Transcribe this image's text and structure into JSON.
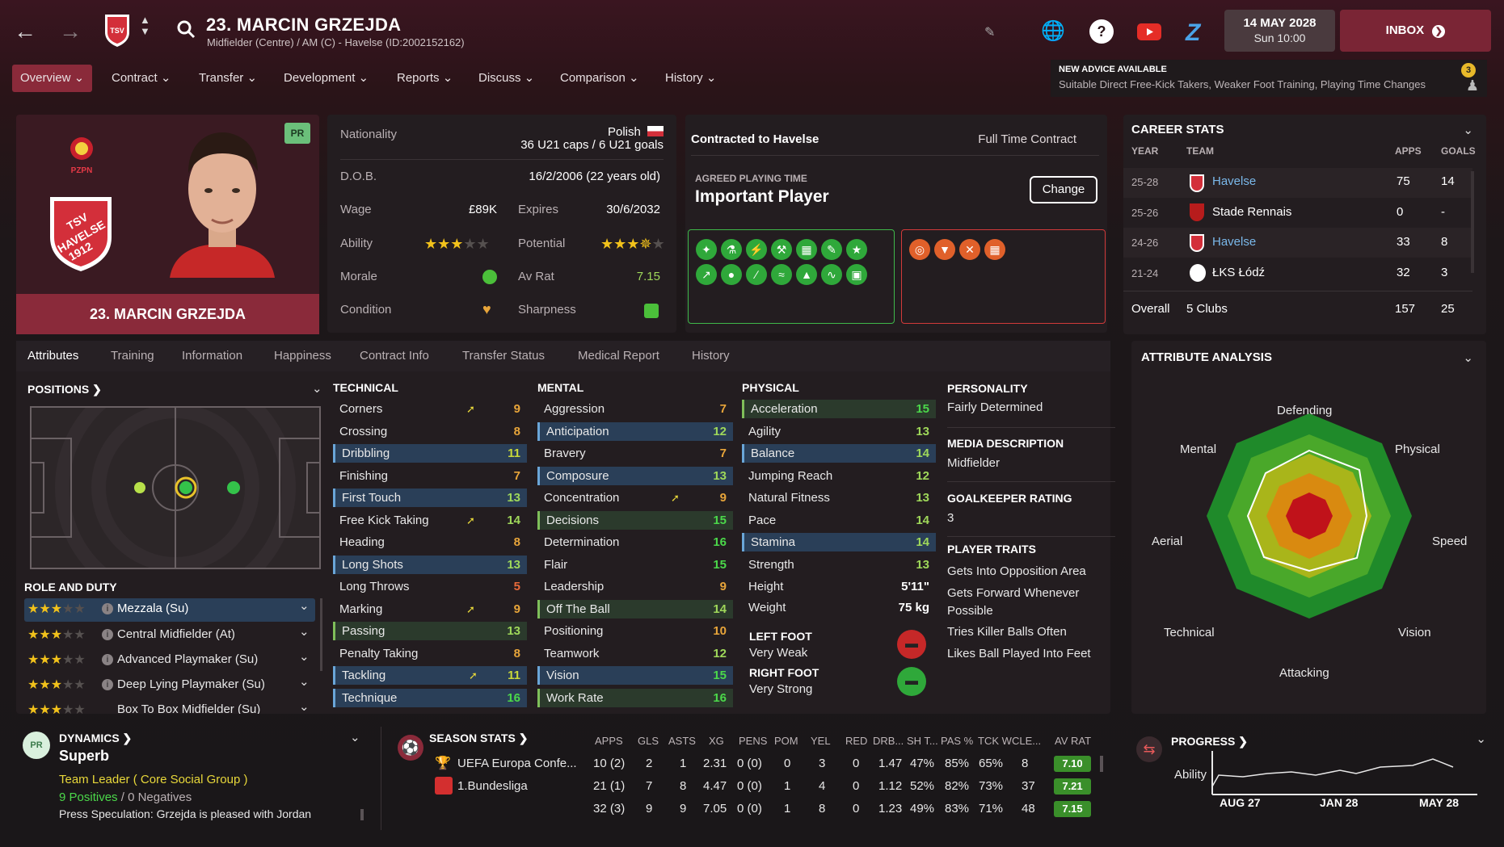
{
  "header": {
    "title": "23. MARCIN GRZEJDA",
    "subtitle": "Midfielder (Centre) / AM (C) - Havelse (ID:2002152162)",
    "date": "14 MAY 2028",
    "time": "Sun 10:00",
    "inbox": "INBOX",
    "menu": [
      "Overview",
      "Contract",
      "Transfer",
      "Development",
      "Reports",
      "Discuss",
      "Comparison",
      "History"
    ]
  },
  "advice": {
    "title": "NEW ADVICE AVAILABLE",
    "text": "Suitable Direct Free-Kick Takers, Weaker Foot Training, Playing Time Changes",
    "count": "3"
  },
  "profile": {
    "name": "23. MARCIN GRZEJDA",
    "badge": "PR",
    "federation": "PZPN",
    "club_badge": "TSV HAVELSE 1912"
  },
  "info": {
    "nationality_label": "Nationality",
    "nationality": "Polish",
    "caps": "36 U21 caps / 6 U21 goals",
    "dob_label": "D.O.B.",
    "dob": "16/2/2006 (22 years old)",
    "wage_label": "Wage",
    "wage": "£89K",
    "expires_label": "Expires",
    "expires": "30/6/2032",
    "ability_label": "Ability",
    "potential_label": "Potential",
    "morale_label": "Morale",
    "avrat_label": "Av Rat",
    "avrat": "7.15",
    "condition_label": "Condition",
    "sharpness_label": "Sharpness"
  },
  "contract": {
    "title": "Contracted to Havelse",
    "type": "Full Time Contract",
    "pt_label": "AGREED PLAYING TIME",
    "pt_value": "Important Player",
    "change": "Change"
  },
  "career": {
    "title": "CAREER STATS",
    "h_year": "YEAR",
    "h_team": "TEAM",
    "h_apps": "APPS",
    "h_goals": "GOALS",
    "rows": [
      {
        "year": "25-28",
        "team": "Havelse",
        "apps": "75",
        "goals": "14"
      },
      {
        "year": "25-26",
        "team": "Stade Rennais",
        "apps": "0",
        "goals": "-"
      },
      {
        "year": "24-26",
        "team": "Havelse",
        "apps": "33",
        "goals": "8"
      },
      {
        "year": "21-24",
        "team": "ŁKS Łódź",
        "apps": "32",
        "goals": "3"
      }
    ],
    "overall_label": "Overall",
    "overall_clubs": "5 Clubs",
    "overall_apps": "157",
    "overall_goals": "25"
  },
  "tabs": [
    "Attributes",
    "Training",
    "Information",
    "Happiness",
    "Contract Info",
    "Transfer Status",
    "Medical Report",
    "History"
  ],
  "positions_title": "POSITIONS",
  "role_title": "ROLE AND DUTY",
  "roles": [
    "Mezzala (Su)",
    "Central Midfielder (At)",
    "Advanced Playmaker (Su)",
    "Deep Lying Playmaker (Su)",
    "Box To Box Midfielder (Su)"
  ],
  "technical": {
    "title": "TECHNICAL",
    "items": [
      {
        "n": "Corners",
        "v": "9"
      },
      {
        "n": "Crossing",
        "v": "8"
      },
      {
        "n": "Dribbling",
        "v": "11"
      },
      {
        "n": "Finishing",
        "v": "7"
      },
      {
        "n": "First Touch",
        "v": "13"
      },
      {
        "n": "Free Kick Taking",
        "v": "14"
      },
      {
        "n": "Heading",
        "v": "8"
      },
      {
        "n": "Long Shots",
        "v": "13"
      },
      {
        "n": "Long Throws",
        "v": "5"
      },
      {
        "n": "Marking",
        "v": "9"
      },
      {
        "n": "Passing",
        "v": "13"
      },
      {
        "n": "Penalty Taking",
        "v": "8"
      },
      {
        "n": "Tackling",
        "v": "11"
      },
      {
        "n": "Technique",
        "v": "16"
      }
    ]
  },
  "mental": {
    "title": "MENTAL",
    "items": [
      {
        "n": "Aggression",
        "v": "7"
      },
      {
        "n": "Anticipation",
        "v": "12"
      },
      {
        "n": "Bravery",
        "v": "7"
      },
      {
        "n": "Composure",
        "v": "13"
      },
      {
        "n": "Concentration",
        "v": "9"
      },
      {
        "n": "Decisions",
        "v": "15"
      },
      {
        "n": "Determination",
        "v": "16"
      },
      {
        "n": "Flair",
        "v": "15"
      },
      {
        "n": "Leadership",
        "v": "9"
      },
      {
        "n": "Off The Ball",
        "v": "14"
      },
      {
        "n": "Positioning",
        "v": "10"
      },
      {
        "n": "Teamwork",
        "v": "12"
      },
      {
        "n": "Vision",
        "v": "15"
      },
      {
        "n": "Work Rate",
        "v": "16"
      }
    ]
  },
  "physical": {
    "title": "PHYSICAL",
    "items": [
      {
        "n": "Acceleration",
        "v": "15"
      },
      {
        "n": "Agility",
        "v": "13"
      },
      {
        "n": "Balance",
        "v": "14"
      },
      {
        "n": "Jumping Reach",
        "v": "12"
      },
      {
        "n": "Natural Fitness",
        "v": "13"
      },
      {
        "n": "Pace",
        "v": "14"
      },
      {
        "n": "Stamina",
        "v": "14"
      },
      {
        "n": "Strength",
        "v": "13"
      },
      {
        "n": "Height",
        "v": "5'11\""
      },
      {
        "n": "Weight",
        "v": "75 kg"
      }
    ]
  },
  "feet": {
    "left_label": "LEFT FOOT",
    "left": "Very Weak",
    "right_label": "RIGHT FOOT",
    "right": "Very Strong"
  },
  "personality": {
    "title": "PERSONALITY",
    "value": "Fairly Determined",
    "media_title": "MEDIA DESCRIPTION",
    "media": "Midfielder",
    "gk_title": "GOALKEEPER RATING",
    "gk": "3",
    "traits_title": "PLAYER TRAITS",
    "traits": [
      "Gets Into Opposition Area",
      "Gets Forward Whenever",
      "Possible",
      "Tries Killer Balls Often",
      "Likes Ball Played Into Feet"
    ]
  },
  "analysis": {
    "title": "ATTRIBUTE ANALYSIS",
    "labels": [
      "Defending",
      "Physical",
      "Speed",
      "Vision",
      "Attacking",
      "Technical",
      "Aerial",
      "Mental"
    ]
  },
  "dynamics": {
    "title": "DYNAMICS",
    "value": "Superb",
    "leader": "Team Leader",
    "group": "( Core Social Group )",
    "positives": "9 Positives",
    "sep": "/",
    "negatives": "0 Negatives",
    "speculation": "Press Speculation: Grzejda is pleased with Jordan"
  },
  "season": {
    "title": "SEASON STATS",
    "headers": [
      "APPS",
      "GLS",
      "ASTS",
      "XG",
      "PENS",
      "POM",
      "YEL",
      "RED",
      "DRB...",
      "SH T...",
      "PAS %",
      "TCK W",
      "CLE...",
      "AV RAT"
    ],
    "rows": [
      {
        "comp": "UEFA Europa Confe...",
        "cells": [
          "10 (2)",
          "2",
          "1",
          "2.31",
          "0 (0)",
          "0",
          "3",
          "0",
          "1.47",
          "47%",
          "85%",
          "65%",
          "8"
        ],
        "rat": "7.10"
      },
      {
        "comp": "1.Bundesliga",
        "cells": [
          "21 (1)",
          "7",
          "8",
          "4.47",
          "0 (0)",
          "1",
          "4",
          "0",
          "1.12",
          "52%",
          "82%",
          "73%",
          "37"
        ],
        "rat": "7.21"
      },
      {
        "comp": "",
        "cells": [
          "32 (3)",
          "9",
          "9",
          "7.05",
          "0 (0)",
          "1",
          "8",
          "0",
          "1.23",
          "49%",
          "83%",
          "71%",
          "48"
        ],
        "rat": "7.15"
      }
    ]
  },
  "progress": {
    "title": "PROGRESS",
    "label": "Ability",
    "ticks": [
      "AUG 27",
      "JAN 28",
      "MAY 28"
    ]
  }
}
